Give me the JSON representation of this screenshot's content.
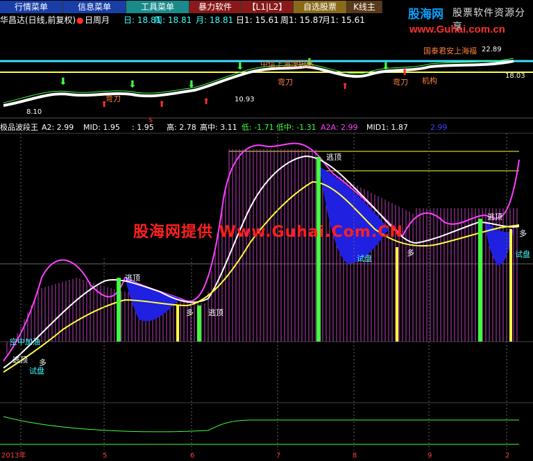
{
  "menu": {
    "tabs": [
      {
        "label": "行情菜单",
        "bg": "#1a3ea8"
      },
      {
        "label": "信息菜单",
        "bg": "#1a3ea8"
      },
      {
        "label": "工具菜单",
        "bg": "#1a8a8a"
      },
      {
        "label": "暴力软件",
        "bg": "#8a1a1a"
      },
      {
        "label": "【L1|L2】",
        "bg": "#8a1a1a"
      },
      {
        "label": "自选股票",
        "bg": "#8a6a1a"
      },
      {
        "label": "K线主",
        "bg": "#5a3a1a"
      }
    ]
  },
  "brand": {
    "logo_cn": "股海网",
    "slogan": "股票软件资源分享",
    "url": "www.Guhai.com.cn"
  },
  "info": {
    "stock": "华昌达(日线,前复权)",
    "cycle_label": "日周月",
    "items": [
      {
        "label": "日: 18.81",
        "color": "#40ffff"
      },
      {
        "label": "周: 18.81",
        "color": "#40ffff"
      },
      {
        "label": "月: 18.81",
        "color": "#40ffff"
      },
      {
        "label": "日1: 15.61",
        "color": "#ffffff"
      },
      {
        "label": "周1: 15.87",
        "color": "#ffffff"
      },
      {
        "label": "月1: 15.61",
        "color": "#ffffff"
      }
    ]
  },
  "upper": {
    "annotations": [
      {
        "text": "中信上海溧阳路",
        "color": "#ff8040"
      },
      {
        "text": "国泰君安上海福",
        "color": "#ff8040"
      },
      {
        "text": "弯刀",
        "color": "#ff8040"
      },
      {
        "text": "弯刀",
        "color": "#ff8040"
      },
      {
        "text": "弯刀",
        "color": "#ff8040"
      },
      {
        "text": "机构",
        "color": "#ff8040"
      },
      {
        "text": "8.10",
        "color": "#ffffff"
      },
      {
        "text": "10.93",
        "color": "#ffffff"
      },
      {
        "text": "22.89",
        "color": "#ffffff"
      },
      {
        "text": "18.03",
        "color": "#ffffff"
      },
      {
        "text": "$",
        "color": "#ff3030"
      }
    ]
  },
  "indicator": {
    "name": "极品波段王",
    "items": [
      {
        "label": "A2: 2.99",
        "color": "#ffffff"
      },
      {
        "label": "MID: 1.95",
        "color": "#ffffff"
      },
      {
        "label": ": 1.95",
        "color": "#ffffff"
      },
      {
        "label": "高: 2.78",
        "color": "#ffffff"
      },
      {
        "label": "高中: 3.11",
        "color": "#ffffff"
      },
      {
        "label": "低: -1.71",
        "color": "#40ff40"
      },
      {
        "label": "低中: -1.31",
        "color": "#40ff40"
      },
      {
        "label": "A2A: 2.99",
        "color": "#ff40ff"
      },
      {
        "label": "MID1: 1.87",
        "color": "#ffffff"
      },
      {
        "label": "2.99",
        "color": "#4040ff"
      }
    ],
    "labels": [
      {
        "text": "逃顶",
        "color": "#ffffff"
      },
      {
        "text": "逃顶",
        "color": "#ffffff"
      },
      {
        "text": "逃顶",
        "color": "#ffffff"
      },
      {
        "text": "逃顶",
        "color": "#ffffff"
      },
      {
        "text": "逃顶",
        "color": "#ffffff"
      },
      {
        "text": "空中加油",
        "color": "#40ffff"
      },
      {
        "text": "试盘",
        "color": "#40ffff"
      },
      {
        "text": "试盘",
        "color": "#40ffff"
      },
      {
        "text": "试盘",
        "color": "#40ffff"
      },
      {
        "text": "多",
        "color": "#ffffff"
      },
      {
        "text": "多",
        "color": "#ffffff"
      },
      {
        "text": "多",
        "color": "#ffffff"
      },
      {
        "text": "多",
        "color": "#ffffff"
      }
    ]
  },
  "watermark": "股海网提供 Www.Guhai.Com.CN",
  "dates": [
    "2013年",
    "5",
    "6",
    "7",
    "8",
    "9",
    "2"
  ]
}
